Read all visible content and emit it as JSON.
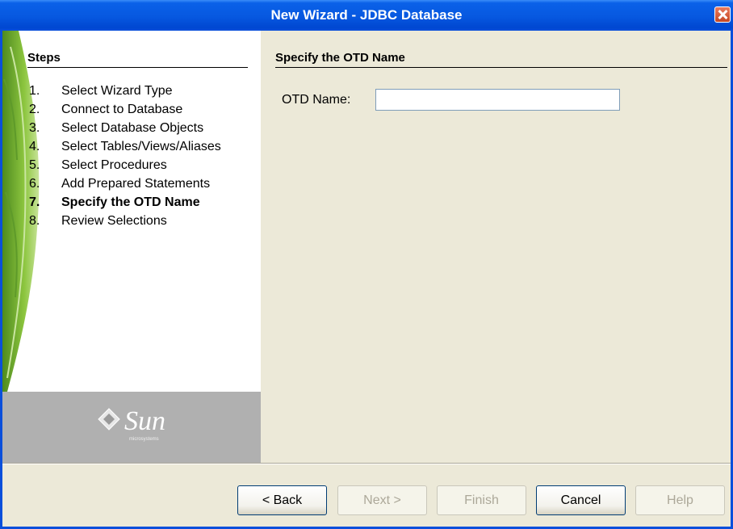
{
  "window": {
    "title": "New Wizard - JDBC Database"
  },
  "steps": {
    "heading": "Steps",
    "items": [
      {
        "num": "1.",
        "label": "Select Wizard Type"
      },
      {
        "num": "2.",
        "label": "Connect to Database"
      },
      {
        "num": "3.",
        "label": "Select Database Objects"
      },
      {
        "num": "4.",
        "label": "Select Tables/Views/Aliases"
      },
      {
        "num": "5.",
        "label": "Select Procedures"
      },
      {
        "num": "6.",
        "label": "Add Prepared Statements"
      },
      {
        "num": "7.",
        "label": "Specify the OTD Name"
      },
      {
        "num": "8.",
        "label": "Review Selections"
      }
    ],
    "current_index": 6
  },
  "logo": {
    "text": "Sun",
    "subtext": "microsystems"
  },
  "content": {
    "heading": "Specify the OTD Name",
    "otd_label": "OTD Name:",
    "otd_value": ""
  },
  "buttons": {
    "back": "< Back",
    "next": "Next >",
    "finish": "Finish",
    "cancel": "Cancel",
    "help": "Help"
  },
  "icons": {
    "close": "close-icon",
    "logo": "sun-logo-icon"
  },
  "colors": {
    "titlebar": "#0A61E8",
    "dialog_bg": "#ECE9D8",
    "logo_bg": "#B0B0B0",
    "leaf": "#7DB33A"
  }
}
